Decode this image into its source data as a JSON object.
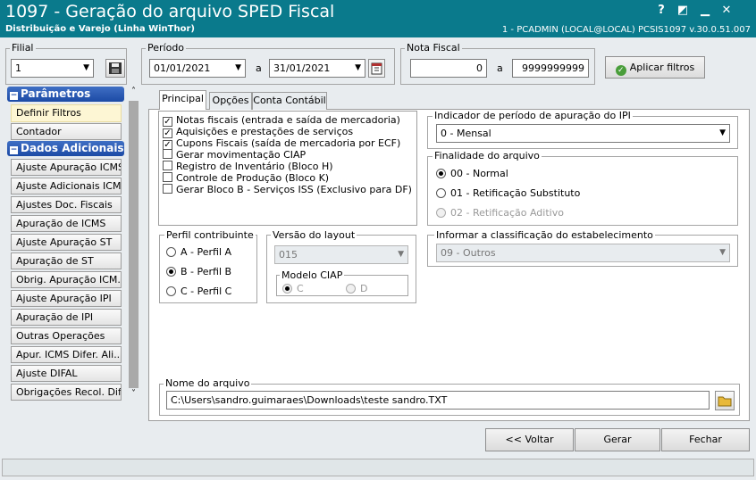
{
  "window": {
    "title": "1097 - Geração do arquivo SPED Fiscal",
    "subtitle": "Distribuição e Varejo (Linha WinThor)",
    "sysinfo": "1 - PCADMIN (LOCAL@LOCAL)   PCSIS1097  v.30.0.51.007",
    "help_label": "?",
    "restore_label": "◩",
    "minimize_label": "▁",
    "close_label": "✕"
  },
  "filters": {
    "filial_label": "Filial",
    "filial_value": "1",
    "periodo_label": "Período",
    "periodo_start": "01/01/2021",
    "periodo_sep": "a",
    "periodo_end": "31/01/2021",
    "nota_label": "Nota Fiscal",
    "nota_start": "0",
    "nota_sep": "a",
    "nota_end": "9999999999",
    "apply_label": "Aplicar filtros"
  },
  "sidebar": {
    "sec1_title": "Parâmetros",
    "sec1_items": [
      "Definir Filtros",
      "Contador"
    ],
    "sec2_title": "Dados Adicionais",
    "sec2_items": [
      "Ajuste Apuração ICMS",
      "Ajuste Adicionais ICMS",
      "Ajustes Doc. Fiscais",
      "Apuração de ICMS",
      "Ajuste Apuração ST",
      "Apuração de ST",
      "Obrig. Apuração ICM...",
      "Ajuste Apuração IPI",
      "Apuração de IPI",
      "Outras Operações",
      "Apur. ICMS Difer. Ali...",
      "Ajuste DIFAL",
      "Obrigações Recol. Difal"
    ]
  },
  "tabs": [
    "Principal",
    "Opções",
    "Conta Contábil"
  ],
  "checklist": [
    {
      "label": "Notas fiscais (entrada e saída de mercadoria)",
      "checked": true
    },
    {
      "label": "Aquisições e prestações de serviços",
      "checked": true
    },
    {
      "label": "Cupons Fiscais (saída de mercadoria por ECF)",
      "checked": true
    },
    {
      "label": "Gerar movimentação CIAP",
      "checked": false
    },
    {
      "label": "Registro de Inventário (Bloco H)",
      "checked": false
    },
    {
      "label": "Controle de Produção (Bloco K)",
      "checked": false
    },
    {
      "label": "Gerar Bloco B - Serviços ISS (Exclusivo para DF)",
      "checked": false
    }
  ],
  "ipi": {
    "label": "Indicador de período de apuração do IPI",
    "value": "0 - Mensal"
  },
  "finalidade": {
    "label": "Finalidade do arquivo",
    "options": [
      "00 - Normal",
      "01 - Retificação Substituto",
      "02 - Retificação Aditivo"
    ],
    "selected": "00 - Normal"
  },
  "perfil": {
    "label": "Perfil contribuinte",
    "options": [
      "A - Perfil A",
      "B - Perfil B",
      "C - Perfil C"
    ],
    "selected": "B - Perfil B"
  },
  "layout": {
    "label": "Versão do layout",
    "value": "015",
    "ciap_label": "Modelo CIAP",
    "ciap_options": [
      "C",
      "D"
    ]
  },
  "classificacao": {
    "label": "Informar a classificação do estabelecimento",
    "value": "09 - Outros"
  },
  "arquivo": {
    "label": "Nome do arquivo",
    "value": "C:\\Users\\sandro.guimaraes\\Downloads\\teste sandro.TXT"
  },
  "footer": {
    "back_label": "<< Voltar",
    "generate_label": "Gerar",
    "close_label": "Fechar"
  },
  "colors": {
    "titlebar": "#0a7a8c",
    "section_header": "#1c4aa5"
  }
}
